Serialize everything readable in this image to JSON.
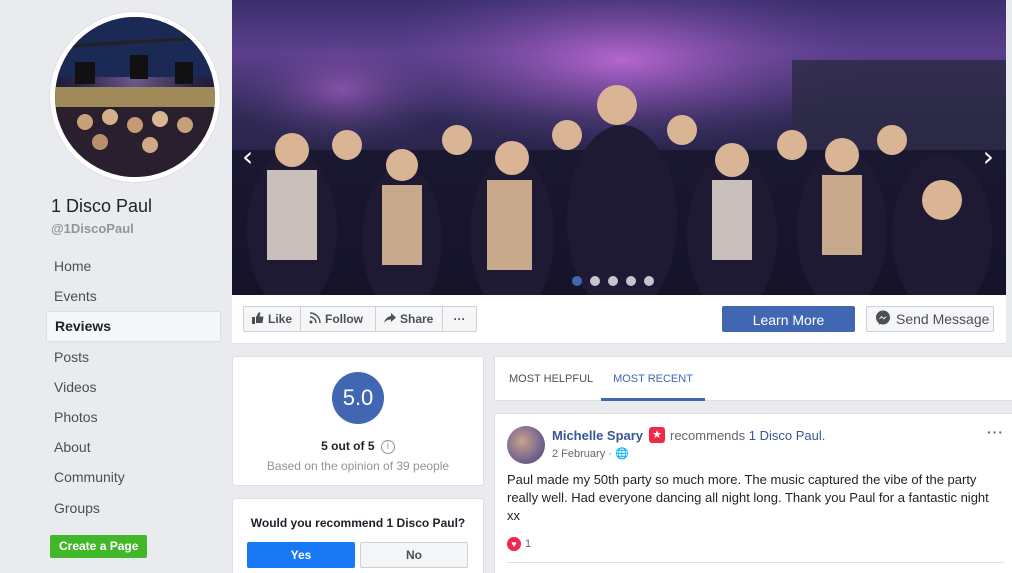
{
  "sidebar": {
    "page_name": "1 Disco Paul",
    "handle": "@1DiscoPaul",
    "nav_items": [
      "Home",
      "Events",
      "Reviews",
      "Posts",
      "Videos",
      "Photos",
      "About",
      "Community",
      "Groups"
    ],
    "active_item": "Reviews",
    "create_page_label": "Create a Page"
  },
  "cover": {
    "carousel_total": 5,
    "carousel_active_index": 0,
    "arrow_left": "‹",
    "arrow_right": "›"
  },
  "actions": {
    "like": "Like",
    "follow": "Follow",
    "share": "Share",
    "more": "···",
    "learn_more": "Learn More",
    "send_message": "Send Message"
  },
  "rating": {
    "score": "5.0",
    "out_of": "5 out of 5",
    "info": "i",
    "basis": "Based on the opinion of 39 people"
  },
  "recommend": {
    "question": "Would you recommend 1 Disco Paul?",
    "yes": "Yes",
    "no": "No"
  },
  "tabs": {
    "helpful": "MOST HELPFUL",
    "recent": "MOST RECENT"
  },
  "review": {
    "author": "Michelle Spary",
    "badge": "★",
    "action": "recommends",
    "page": "1 Disco Paul.",
    "date": "2 February · 🌐",
    "text": "Paul made my 50th party so much more. The music captured the vibe of the party really well. Had everyone dancing all night long. Thank you Paul for a fantastic night xx",
    "reactions_count": "1",
    "menu": "···"
  },
  "colors": {
    "brand_blue": "#4267b2",
    "link_blue": "#365899",
    "green": "#42b72a",
    "heart_red": "#f0284a"
  }
}
